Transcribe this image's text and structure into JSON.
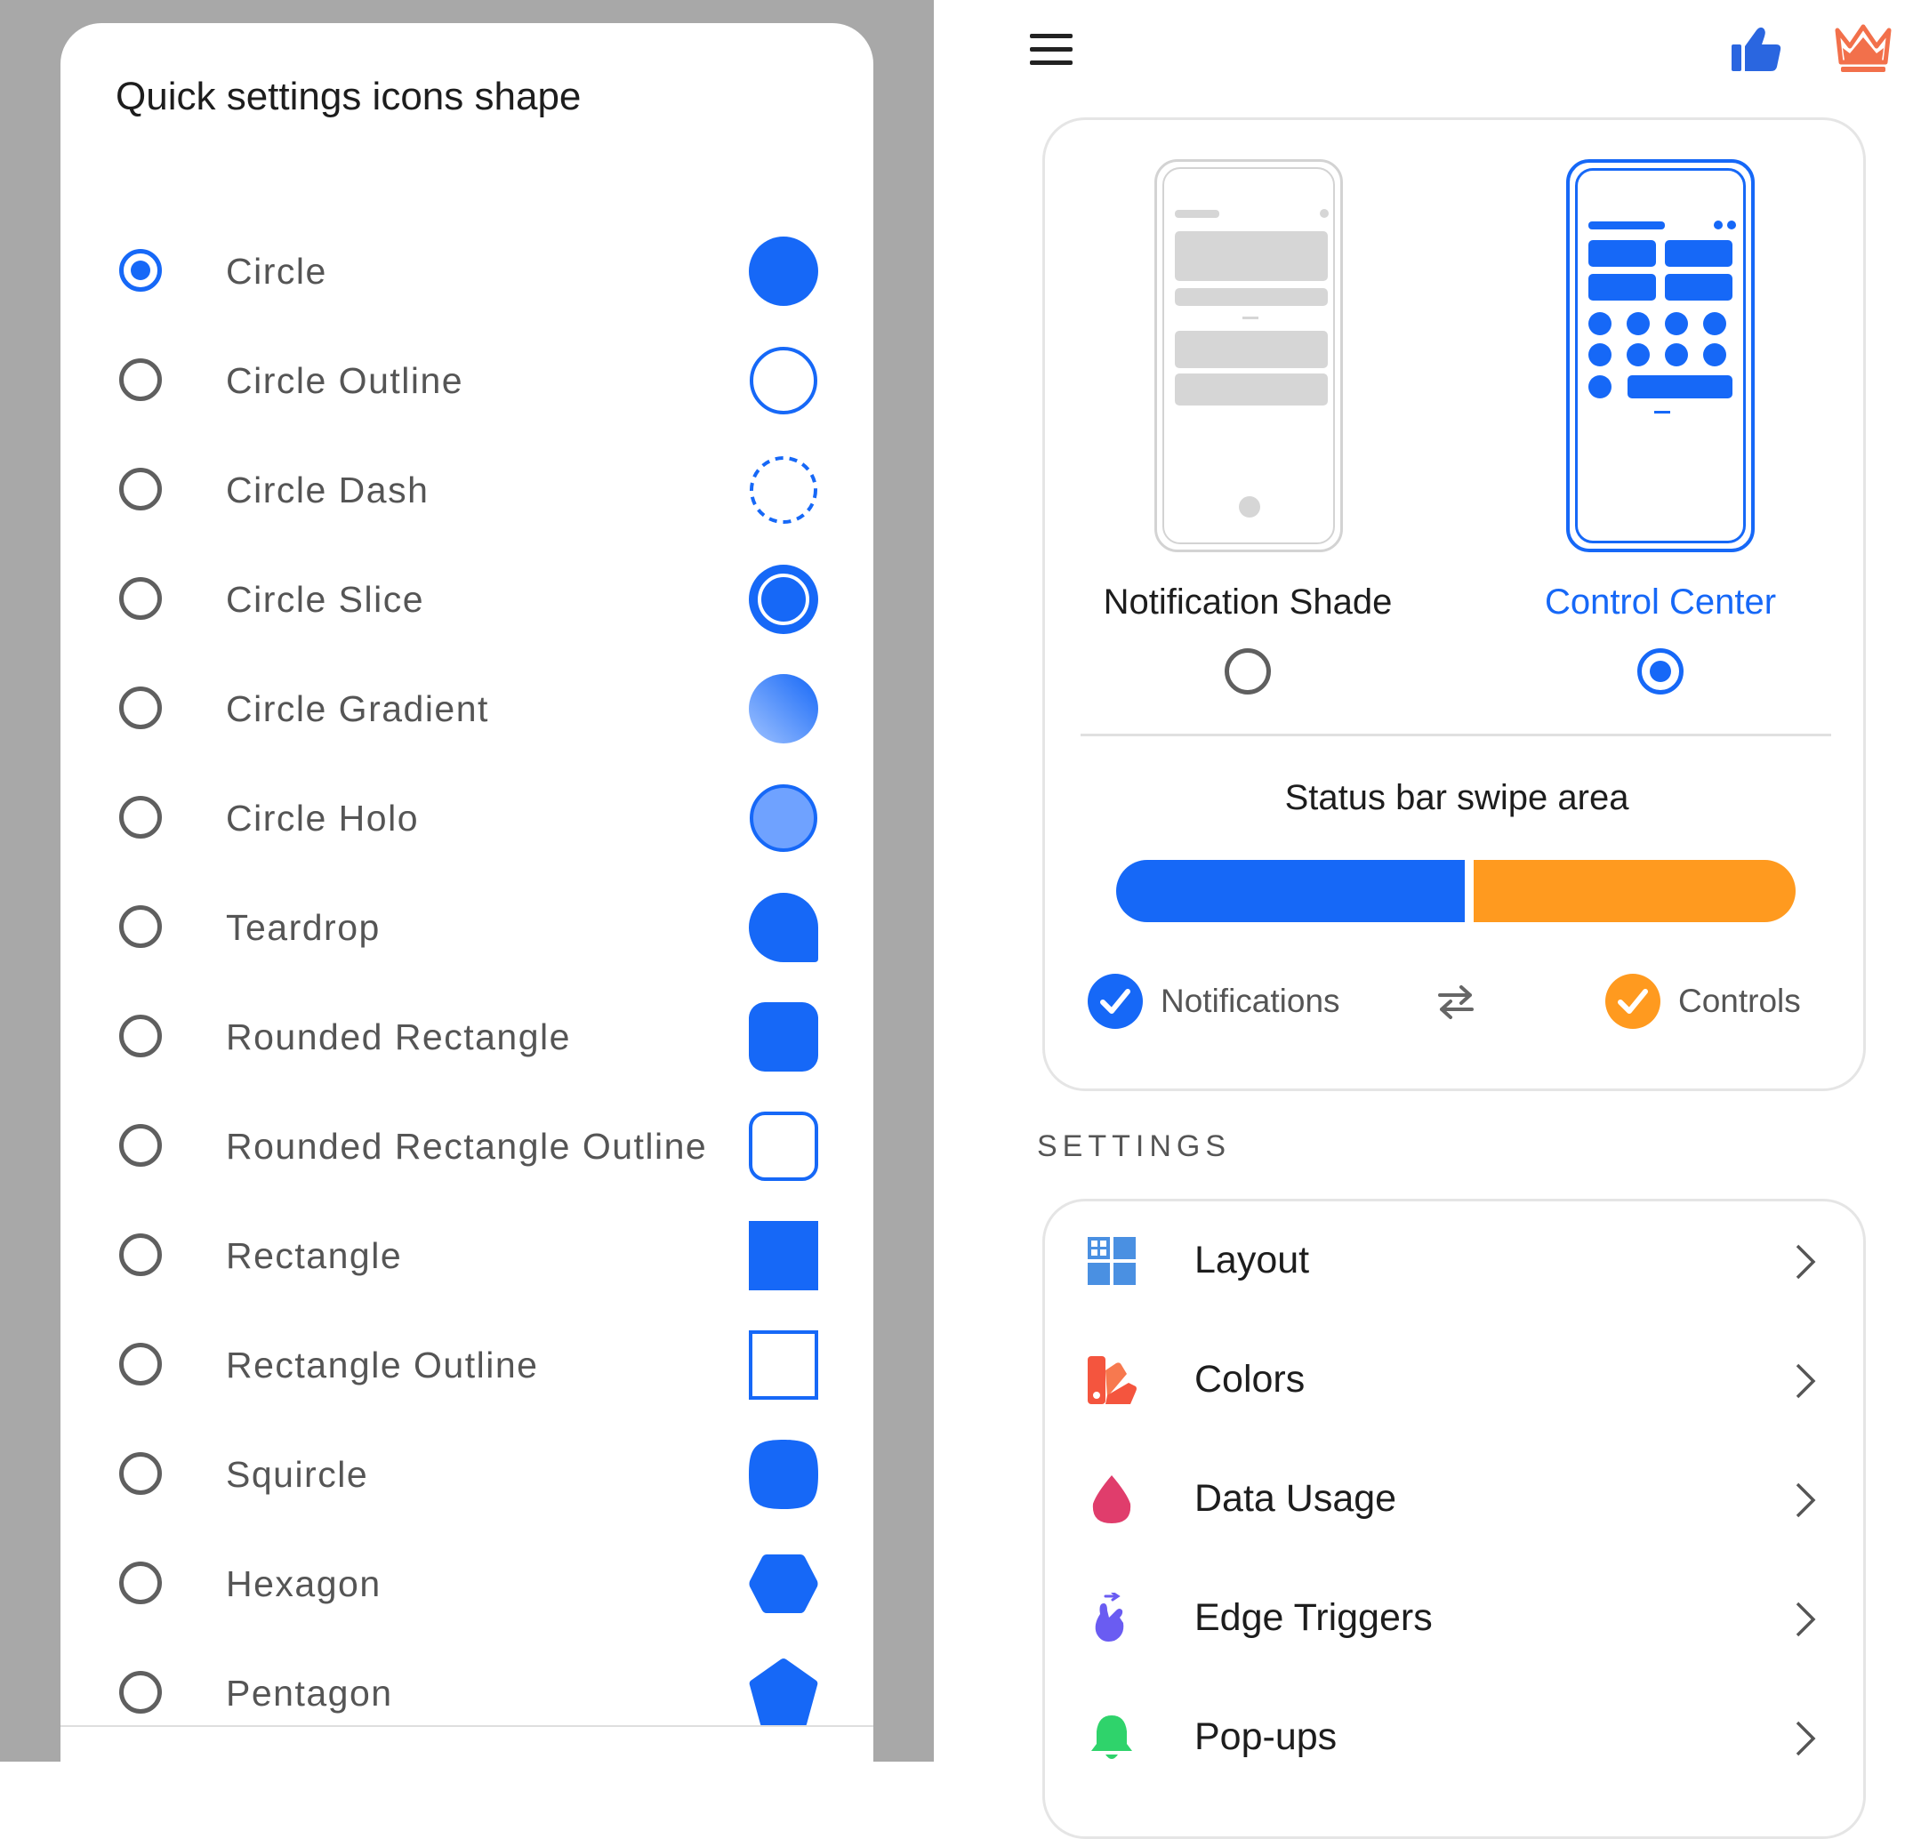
{
  "dialog": {
    "title": "Quick settings icons shape",
    "selected": "Circle",
    "options": [
      {
        "label": "Circle",
        "icon": "circle-shape-icon",
        "selected": true
      },
      {
        "label": "Circle Outline",
        "icon": "circle-outline-shape-icon",
        "selected": false
      },
      {
        "label": "Circle Dash",
        "icon": "circle-dash-shape-icon",
        "selected": false
      },
      {
        "label": "Circle Slice",
        "icon": "circle-slice-shape-icon",
        "selected": false
      },
      {
        "label": "Circle Gradient",
        "icon": "circle-gradient-shape-icon",
        "selected": false
      },
      {
        "label": "Circle Holo",
        "icon": "circle-holo-shape-icon",
        "selected": false
      },
      {
        "label": "Teardrop",
        "icon": "teardrop-shape-icon",
        "selected": false
      },
      {
        "label": "Rounded Rectangle",
        "icon": "rounded-rectangle-shape-icon",
        "selected": false
      },
      {
        "label": "Rounded Rectangle Outline",
        "icon": "rounded-rectangle-outline-shape-icon",
        "selected": false
      },
      {
        "label": "Rectangle",
        "icon": "rectangle-shape-icon",
        "selected": false
      },
      {
        "label": "Rectangle Outline",
        "icon": "rectangle-outline-shape-icon",
        "selected": false
      },
      {
        "label": "Squircle",
        "icon": "squircle-shape-icon",
        "selected": false
      },
      {
        "label": "Hexagon",
        "icon": "hexagon-shape-icon",
        "selected": false
      },
      {
        "label": "Pentagon",
        "icon": "pentagon-shape-icon",
        "selected": false
      }
    ]
  },
  "toolbar": {
    "menu_icon": "hamburger-menu-icon",
    "like_icon": "thumbs-up-icon",
    "premium_icon": "crown-icon"
  },
  "modes": {
    "shade_label": "Notification Shade",
    "cc_label": "Control Center",
    "selected": "Control Center"
  },
  "swipe": {
    "title": "Status bar swipe area",
    "notifications_fraction": 0.51,
    "notifications_label": "Notifications",
    "controls_label": "Controls",
    "swap_icon": "swap-arrows-icon"
  },
  "settings": {
    "header": "SETTINGS",
    "items": [
      {
        "label": "Layout",
        "icon": "layout-grid-icon"
      },
      {
        "label": "Colors",
        "icon": "color-palette-icon"
      },
      {
        "label": "Data Usage",
        "icon": "drop-icon"
      },
      {
        "label": "Edge Triggers",
        "icon": "swipe-hand-icon"
      },
      {
        "label": "Pop-ups",
        "icon": "bell-icon"
      }
    ]
  },
  "colors": {
    "accent": "#1668f7",
    "notifications": "#1668f7",
    "controls": "#ff9a1f",
    "dim_backdrop": "#a8a8a8"
  }
}
